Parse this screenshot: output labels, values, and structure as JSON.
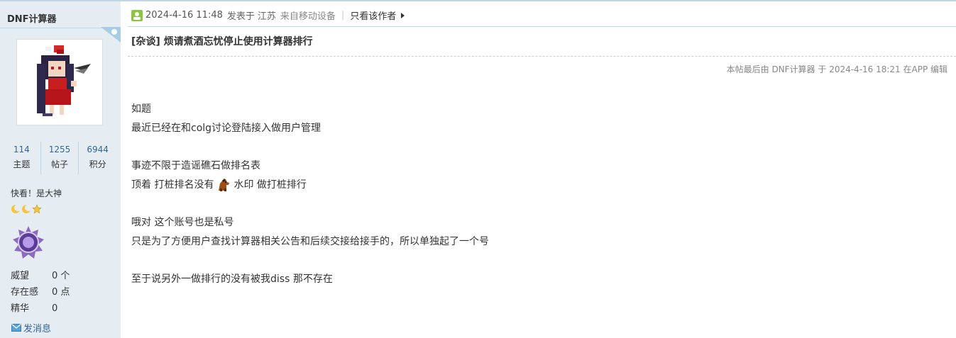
{
  "author": {
    "name": "DNF计算器",
    "stats": [
      {
        "value": "114",
        "label": "主题"
      },
      {
        "value": "1255",
        "label": "帖子"
      },
      {
        "value": "6944",
        "label": "积分"
      }
    ],
    "user_title": "快看！是大神",
    "info": [
      {
        "label": "威望",
        "value": "0 个"
      },
      {
        "label": "存在感",
        "value": "0 点"
      },
      {
        "label": "精华",
        "value": "0"
      }
    ],
    "send_message": "发消息"
  },
  "post": {
    "time": "2024-4-16 11:48",
    "posted_at": "发表于",
    "location": "江苏",
    "from": "来自移动设备",
    "separator": "|",
    "only_author": "只看该作者",
    "title": "[杂谈] 烦请煮酒忘忧停止使用计算器排行",
    "edit_note": "本帖最后由 DNF计算器 于 2024-4-16 18:21 在APP 编辑",
    "lines": {
      "l1": "如题",
      "l2": "最近已经在和colg讨论登陆接入做用户管理",
      "l3": "事迹不限于造谣礁石做排名表",
      "l4_a": "顶着 打桩排名没有",
      "l4_b": "水印 做打桩排行",
      "l5": "哦对 这个账号也是私号",
      "l6": "只是为了方便用户查找计算器相关公告和后续交接给接手的，所以单独起了一个号",
      "l7": "至于说另外一做排行的没有被我diss 那不存在"
    }
  },
  "colors": {
    "sidebar_bg": "#e5edf2",
    "border": "#c2d5e3",
    "link_blue": "#336699",
    "text": "#333333"
  }
}
